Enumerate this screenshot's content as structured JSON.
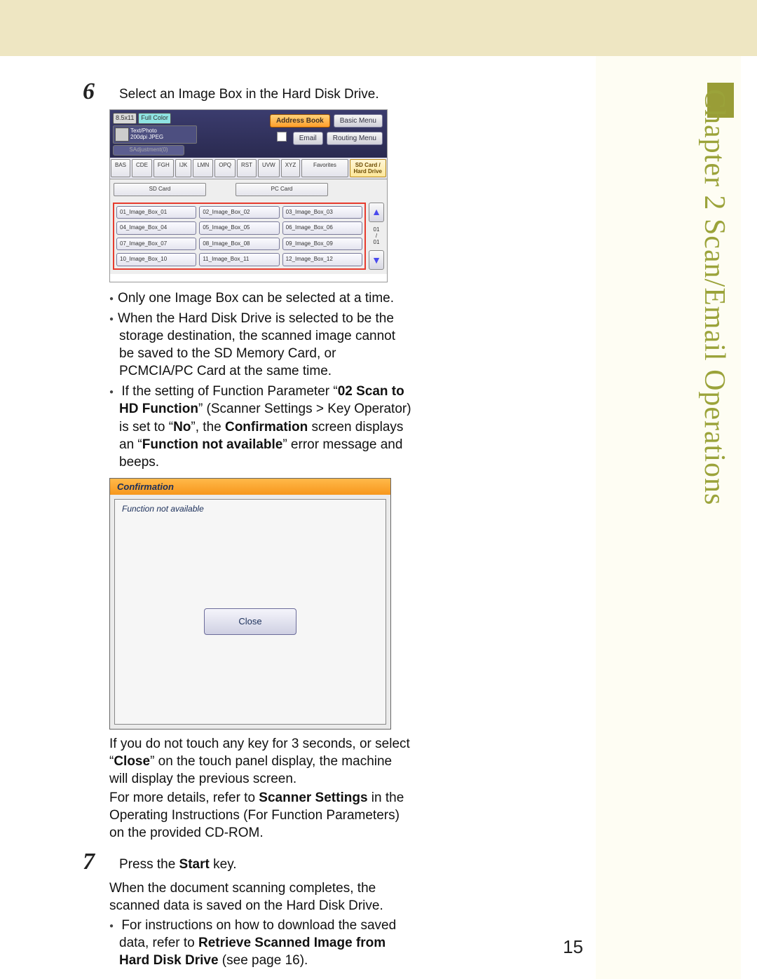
{
  "chapter": "Chapter 2   Scan/Email Operations",
  "page_number": "15",
  "steps": [
    {
      "num": "6",
      "text": "Select an Image Box in the Hard Disk Drive."
    },
    {
      "num": "7",
      "text_prefix": "Press the ",
      "bold": "Start",
      "text_suffix": " key."
    }
  ],
  "panel1": {
    "chip_size": "8.5x11",
    "chip_color": "Full Color",
    "info_line1": "Text/Photo",
    "info_line2": "200dpi JPEG",
    "slot": "SAdjustment(0)",
    "btn_address": "Address Book",
    "btn_basic": "Basic Menu",
    "btn_email": "Email",
    "btn_routing": "Routing Menu",
    "tabs": [
      "BAS",
      "CDE",
      "FGH",
      "IJK",
      "LMN",
      "OPQ",
      "RST",
      "UVW",
      "XYZ"
    ],
    "tab_fav": "Favorites",
    "tab_active_l1": "SD Card /",
    "tab_active_l2": "Hard Drive",
    "mid_left": "SD Card",
    "mid_right": "PC Card",
    "boxes": [
      "01_Image_Box_01",
      "02_Image_Box_02",
      "03_Image_Box_03",
      "04_Image_Box_04",
      "05_Image_Box_05",
      "06_Image_Box_06",
      "07_Image_Box_07",
      "08_Image_Box_08",
      "09_Image_Box_09",
      "10_Image_Box_10",
      "11_Image_Box_11",
      "12_Image_Box_12"
    ],
    "page_ind_top": "01",
    "page_ind_bot": "01"
  },
  "bullets6": {
    "b1": "Only one Image Box can be selected at a time.",
    "b2": "When the Hard Disk Drive is selected to be the storage destination, the scanned image cannot be saved to the SD Memory Card, or PCMCIA/PC Card at the same time.",
    "b3_pre": "If the setting of Function Parameter “",
    "b3_bold1": "02 Scan to HD Function",
    "b3_mid1": "” (Scanner Settings > Key Operator) is set to “",
    "b3_bold2": "No",
    "b3_mid2": "”, the ",
    "b3_bold3": "Confirmation",
    "b3_mid3": " screen displays an “",
    "b3_bold4": "Function not available",
    "b3_end": "” error message and beeps."
  },
  "dialog": {
    "title": "Confirmation",
    "message": "Function not available",
    "close": "Close"
  },
  "after_dlg": {
    "p1a": "If you do not touch any key for 3 seconds, or select “",
    "p1b": "Close",
    "p1c": "” on the touch panel display, the machine will display the previous screen.",
    "p2a": "For more details, refer to ",
    "p2b": "Scanner Settings",
    "p2c": " in the Operating Instructions (For Function Parameters) on the provided CD-ROM."
  },
  "step7": {
    "p1": "When the document scanning completes, the scanned data is saved on the Hard Disk Drive.",
    "b_pre": "For instructions on how to download the saved data, refer to ",
    "b_bold": "Retrieve Scanned Image from Hard Disk Drive",
    "b_post": " (see page 16)."
  }
}
